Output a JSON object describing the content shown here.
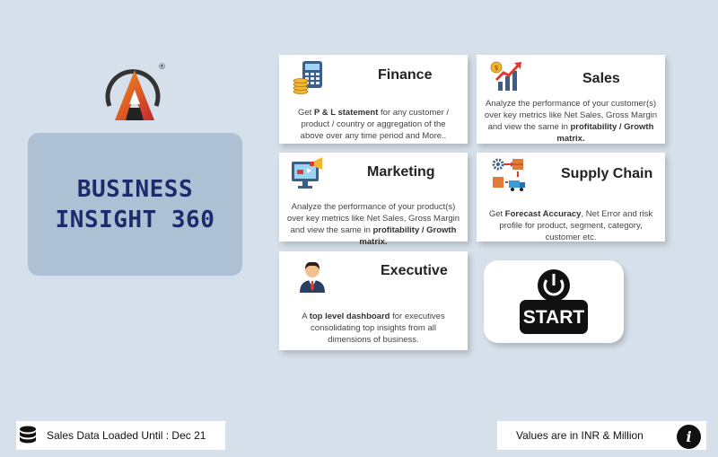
{
  "brand": {
    "registered_mark": "®"
  },
  "title": {
    "line1": "BUSINESS",
    "line2": "INSIGHT 360"
  },
  "cards": {
    "finance": {
      "title": "Finance",
      "desc_pre": "Get ",
      "desc_bold": "P & L statement",
      "desc_post": " for any customer / product / country or aggregation of the above over any time period and More..",
      "icon": "calculator-coins-icon"
    },
    "sales": {
      "title": "Sales",
      "desc_pre": "Analyze the performance of your customer(s) over key metrics like Net Sales, Gross Margin and view the same in ",
      "desc_bold": "profitability / Growth matrix.",
      "icon": "growth-chart-icon"
    },
    "marketing": {
      "title": "Marketing",
      "desc_pre": "Analyze the performance of your product(s) over key metrics like Net Sales, Gross Margin and view the same in ",
      "desc_bold": "profitability / Growth matrix.",
      "icon": "monitor-megaphone-icon"
    },
    "supply_chain": {
      "title": "Supply Chain",
      "desc_pre": "Get ",
      "desc_bold": "Forecast Accuracy",
      "desc_post": ", Net Error and risk profile for product, segment, category, customer etc.",
      "icon": "logistics-icon"
    },
    "executive": {
      "title": "Executive",
      "desc_pre": "A ",
      "desc_bold": "top level dashboard",
      "desc_post": " for executives consolidating top insights from all dimensions of business.",
      "icon": "businessman-icon"
    }
  },
  "start": {
    "label": "START",
    "icon": "power-icon"
  },
  "footer": {
    "data_loaded": "Sales Data Loaded Until : Dec 21",
    "units": "Values are in INR & Million",
    "info_glyph": "i"
  },
  "colors": {
    "background": "#d6e0ea",
    "title_panel": "#aec1d4",
    "title_text": "#1d2a6b",
    "logo_orange": "#f05a28",
    "logo_red": "#c1272d"
  }
}
